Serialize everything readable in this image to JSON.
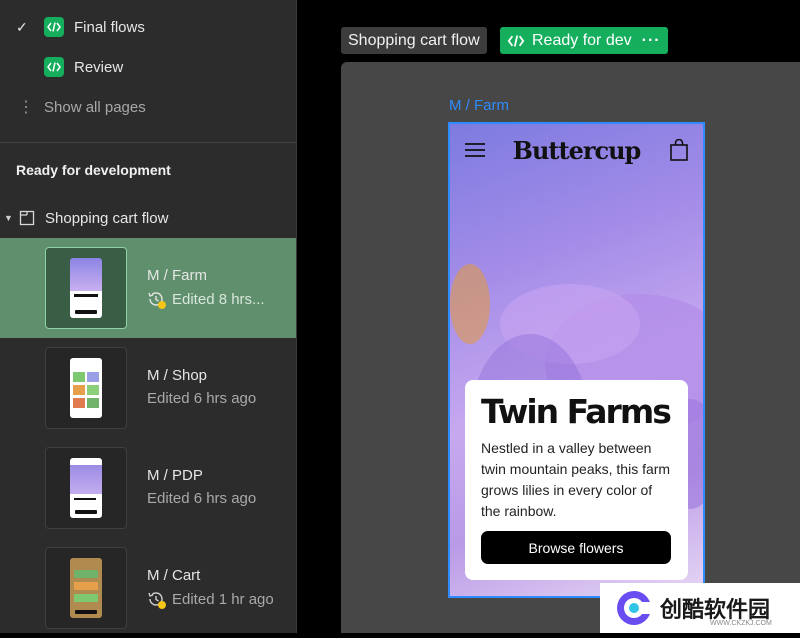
{
  "sidebar": {
    "pages": [
      {
        "label": "Final flows",
        "checked": true
      },
      {
        "label": "Review",
        "checked": false
      }
    ],
    "show_all": "Show all pages",
    "section_title": "Ready for development",
    "flow_name": "Shopping cart flow",
    "items": [
      {
        "title": "M / Farm",
        "subtitle": "Edited 8 hrs..."
      },
      {
        "title": "M / Shop",
        "subtitle": "Edited 6 hrs ago"
      },
      {
        "title": "M / PDP",
        "subtitle": "Edited 6 hrs ago"
      },
      {
        "title": "M / Cart",
        "subtitle": "Edited 1 hr ago"
      }
    ]
  },
  "canvas": {
    "flow_tag": "Shopping cart flow",
    "status_tag": "Ready for dev",
    "frame_label": "M / Farm"
  },
  "phone": {
    "brand": "Buttercup",
    "card_title": "Twin Farms",
    "card_body": "Nestled in a valley between twin mountain peaks, this farm grows lilies in every color of the rainbow.",
    "button_label": "Browse flowers"
  },
  "watermark": {
    "text": "创酷软件园",
    "url": "WWW.CKZKJ.COM"
  },
  "colors": {
    "accent_green": "#14ae5c",
    "selection_blue": "#2f8cff",
    "selected_row": "#5f8f6c"
  }
}
